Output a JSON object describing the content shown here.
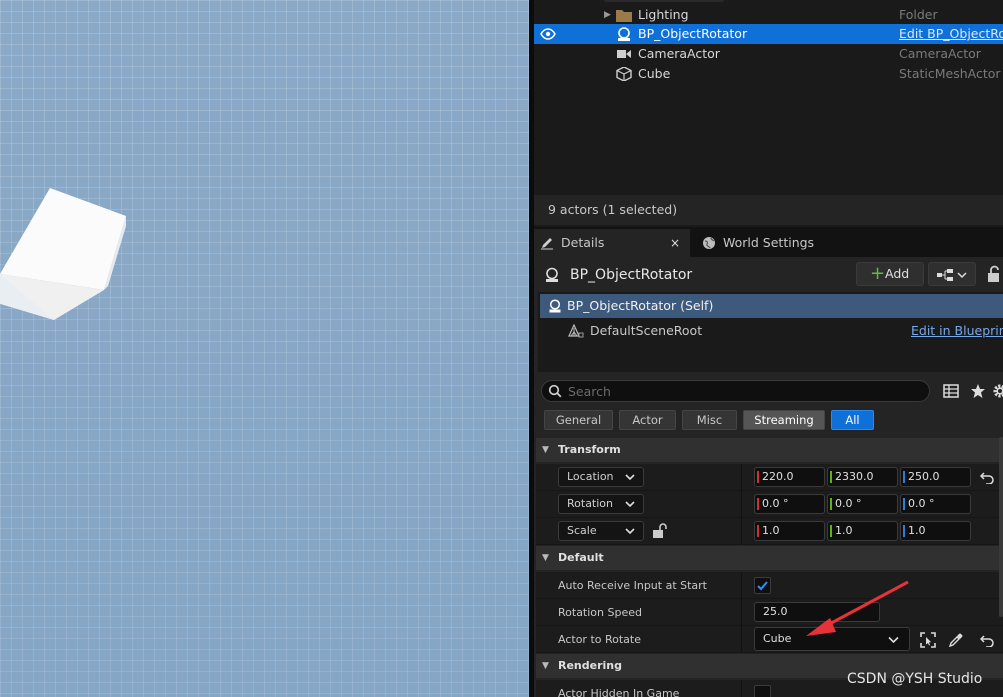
{
  "outliner": {
    "rows": [
      {
        "name": "Lighting",
        "type": "Folder"
      },
      {
        "name": "BP_ObjectRotator",
        "type": "Edit BP_ObjectRot"
      },
      {
        "name": "CameraActor",
        "type": "CameraActor"
      },
      {
        "name": "Cube",
        "type": "StaticMeshActor"
      }
    ],
    "actor_count": "9 actors (1 selected)"
  },
  "tabs": {
    "details": "Details",
    "details_close": "×",
    "world_settings": "World Settings"
  },
  "details": {
    "actor_name": "BP_ObjectRotator",
    "add_label": "Add",
    "components": {
      "self": "BP_ObjectRotator (Self)",
      "root": "DefaultSceneRoot",
      "edit_blueprint": "Edit in Blueprint"
    },
    "search_placeholder": "Search",
    "filters": [
      "General",
      "Actor",
      "Misc",
      "Streaming",
      "All"
    ],
    "transform": {
      "header": "Transform",
      "location": {
        "label": "Location",
        "x": "220.0",
        "y": "2330.0",
        "z": "250.0"
      },
      "rotation": {
        "label": "Rotation",
        "x": "0.0 °",
        "y": "0.0 °",
        "z": "0.0 °"
      },
      "scale": {
        "label": "Scale",
        "x": "1.0",
        "y": "1.0",
        "z": "1.0"
      }
    },
    "default": {
      "header": "Default",
      "auto_receive_label": "Auto Receive Input at Start",
      "auto_receive_checked": true,
      "rotation_speed_label": "Rotation Speed",
      "rotation_speed_value": "25.0",
      "actor_to_rotate_label": "Actor to Rotate",
      "actor_to_rotate_value": "Cube"
    },
    "rendering": {
      "header": "Rendering",
      "hidden_label": "Actor Hidden In Game"
    }
  },
  "watermark": "CSDN @YSH Studio",
  "colors": {
    "selection": "#0f70d8",
    "annotation_arrow": "#e8323a"
  }
}
